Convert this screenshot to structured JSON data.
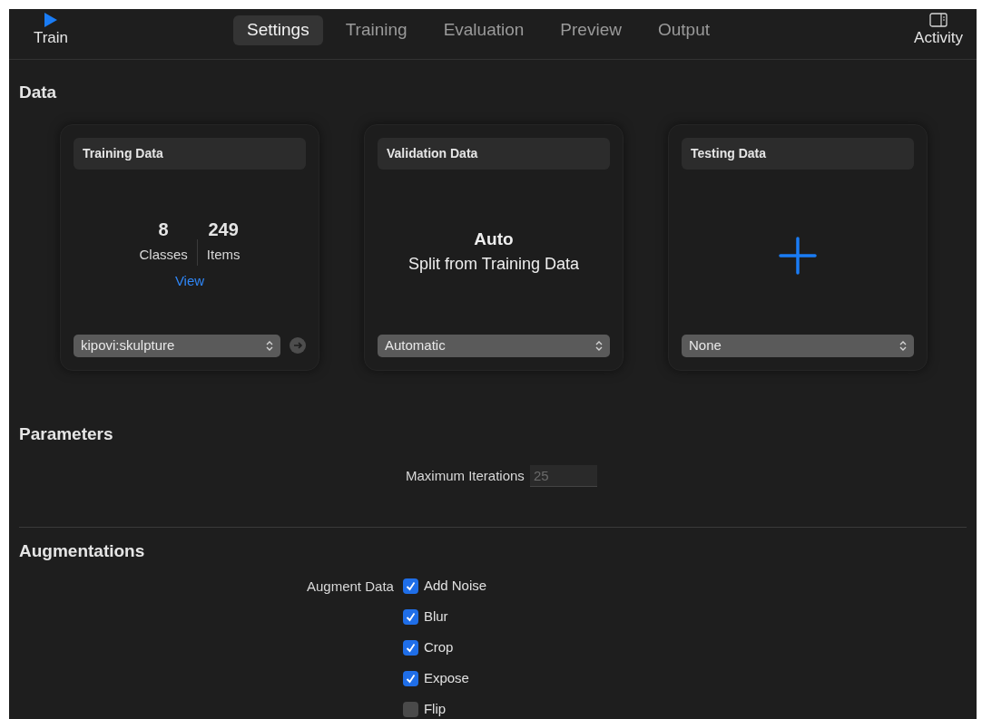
{
  "toolbar": {
    "train": "Train",
    "activity": "Activity"
  },
  "tabs": [
    {
      "label": "Settings",
      "selected": true
    },
    {
      "label": "Training",
      "selected": false
    },
    {
      "label": "Evaluation",
      "selected": false
    },
    {
      "label": "Preview",
      "selected": false
    },
    {
      "label": "Output",
      "selected": false
    }
  ],
  "data_section": {
    "title": "Data",
    "cards": [
      {
        "kind": "stats",
        "title": "Training Data",
        "stats": [
          {
            "value": "8",
            "label": "Classes"
          },
          {
            "value": "249",
            "label": "Items"
          }
        ],
        "link": "View",
        "select": "kipovi:skulpture",
        "go_button": true
      },
      {
        "kind": "text",
        "title": "Validation Data",
        "heading": "Auto",
        "subtext": "Split from Training Data",
        "select": "Automatic",
        "go_button": false
      },
      {
        "kind": "add",
        "title": "Testing Data",
        "select": "None",
        "go_button": false
      }
    ]
  },
  "parameters": {
    "title": "Parameters",
    "fields": [
      {
        "label": "Maximum Iterations",
        "placeholder": "25"
      }
    ]
  },
  "augmentations": {
    "title": "Augmentations",
    "label": "Augment Data",
    "options": [
      {
        "label": "Add Noise",
        "checked": true
      },
      {
        "label": "Blur",
        "checked": true
      },
      {
        "label": "Crop",
        "checked": true
      },
      {
        "label": "Expose",
        "checked": true
      },
      {
        "label": "Flip",
        "checked": false
      }
    ]
  }
}
